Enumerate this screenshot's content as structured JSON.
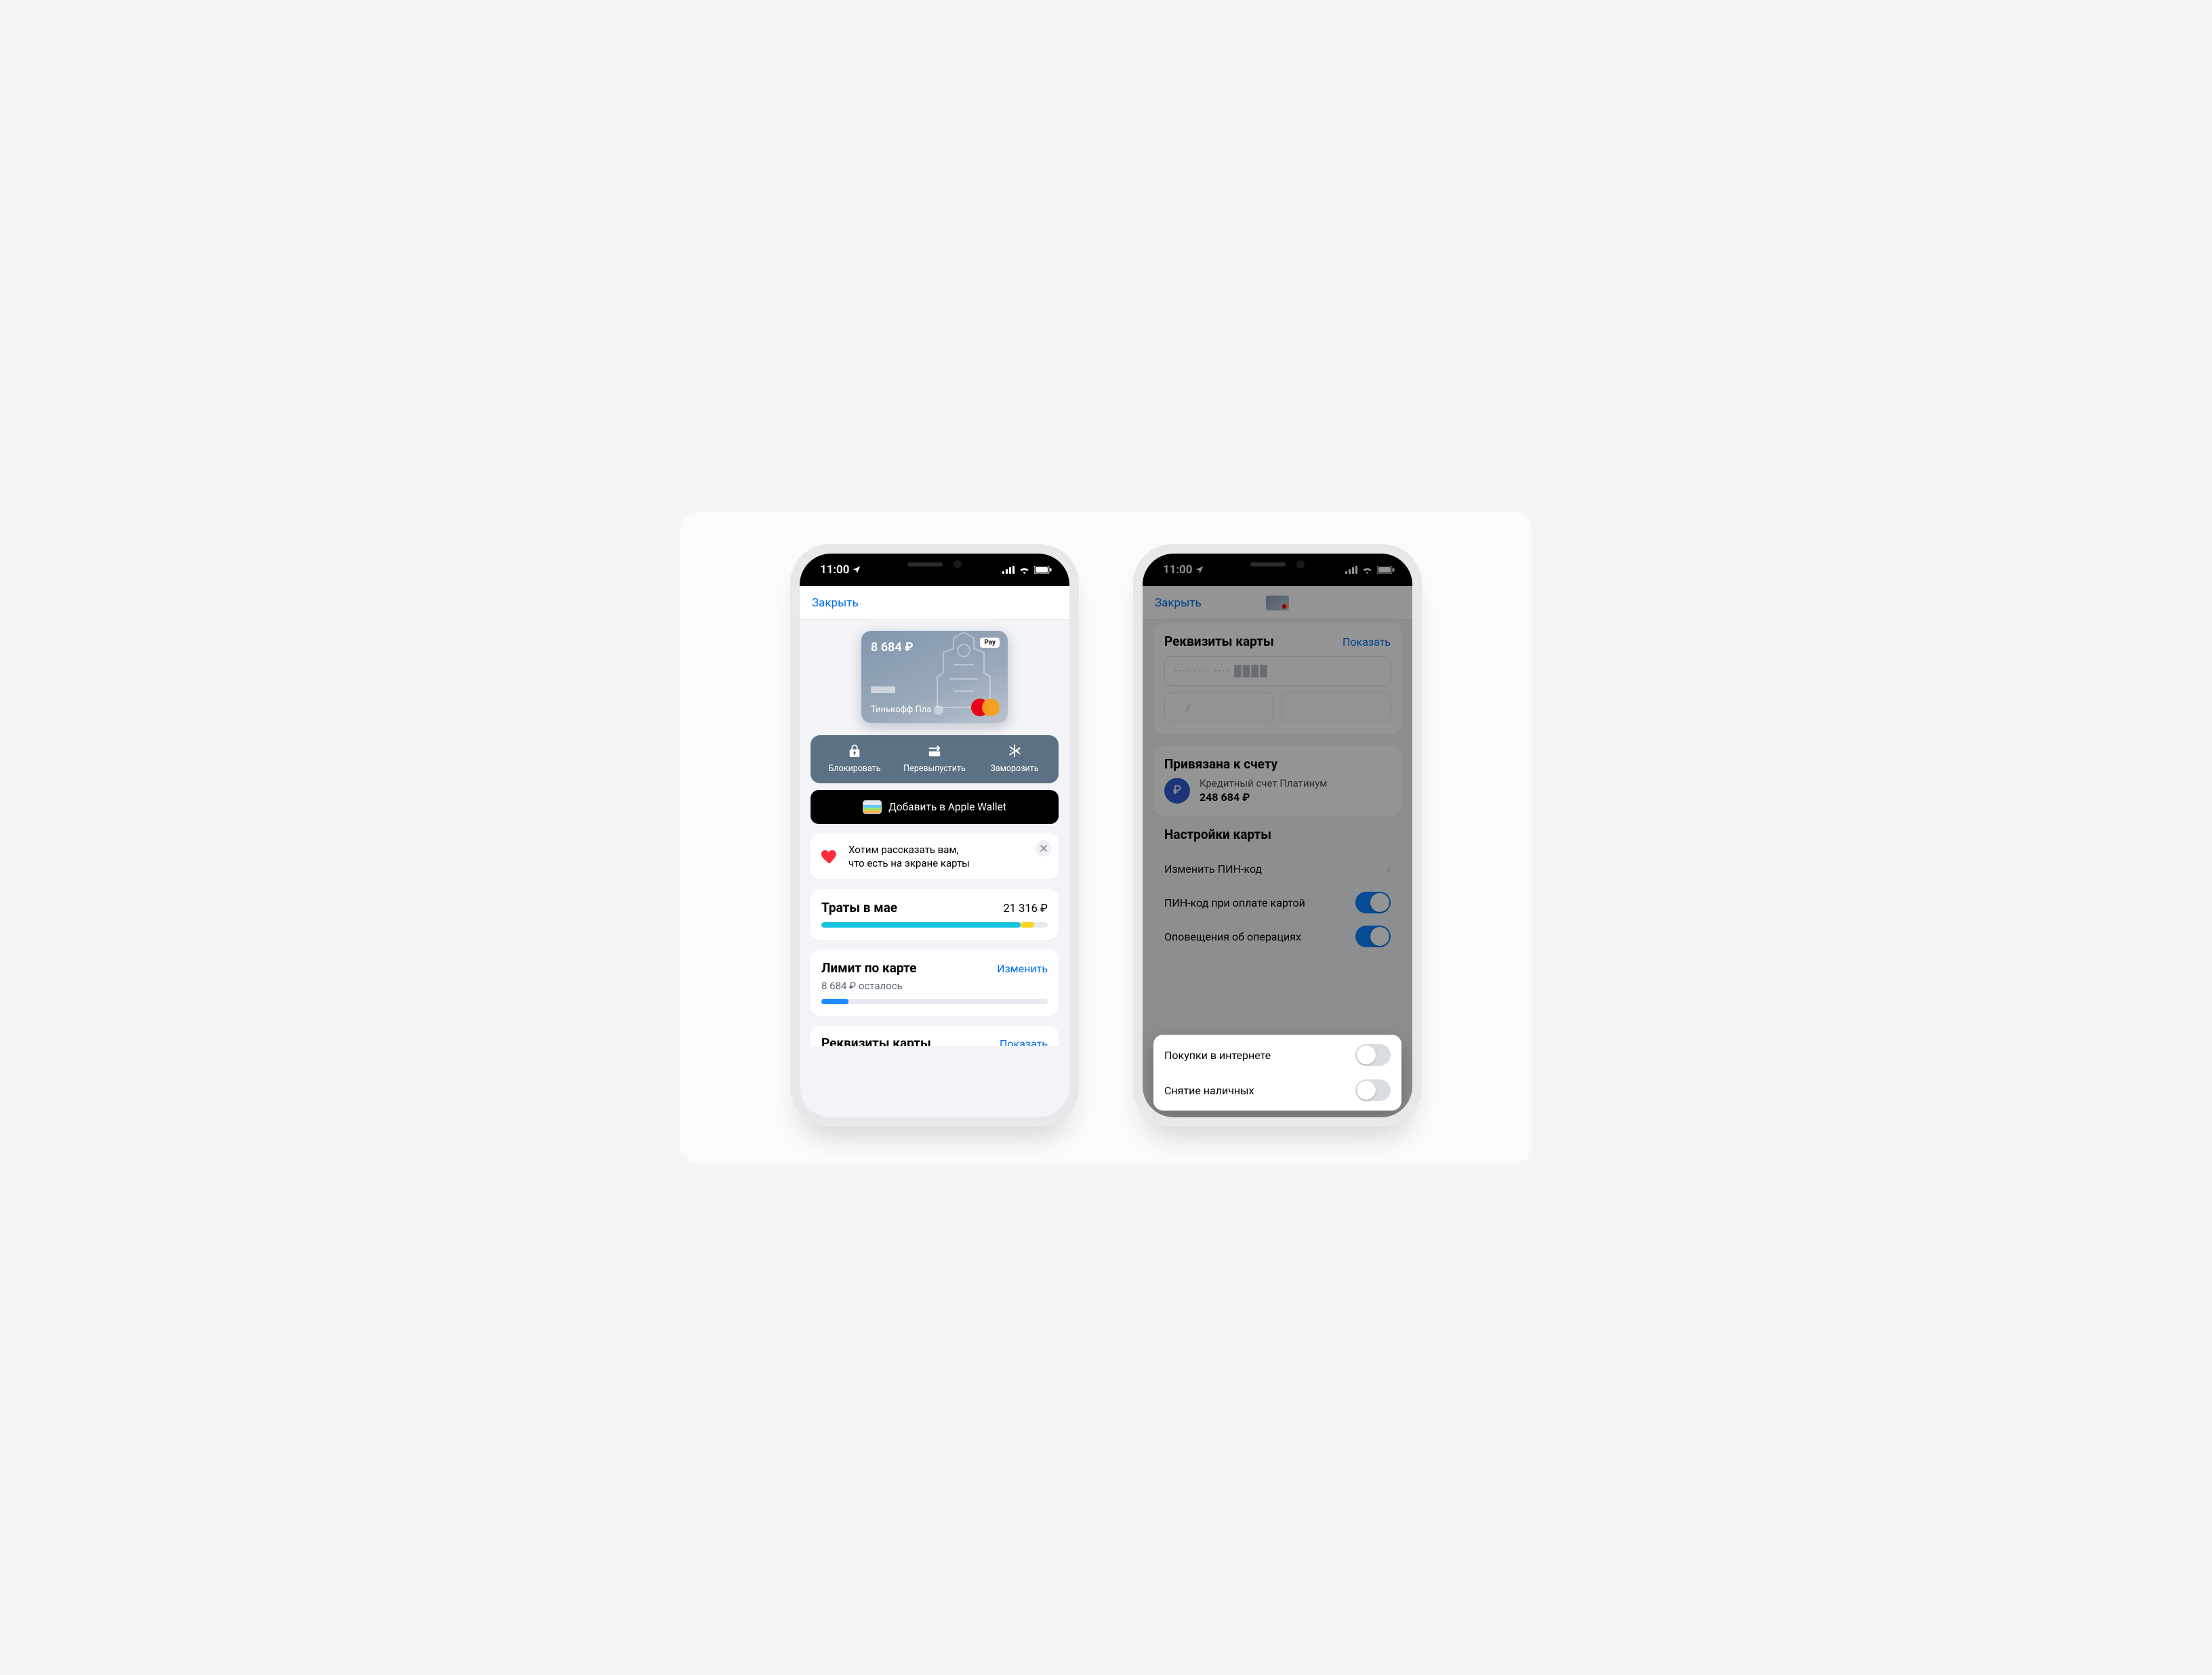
{
  "status": {
    "time": "11:00"
  },
  "nav": {
    "close": "Закрыть"
  },
  "card": {
    "balance": "8 684 ₽",
    "apple_pay_badge": "Pay",
    "product_label": "Тинькофф Пла"
  },
  "actions": {
    "block": "Блокировать",
    "reissue": "Перевыпустить",
    "freeze": "Заморозить"
  },
  "wallet_button": "Добавить в Apple Wallet",
  "info_tip": {
    "line1": "Хотим рассказать вам,",
    "line2": "что есть на экране карты"
  },
  "spend": {
    "title": "Траты в мае",
    "amount": "21 316 ₽",
    "progress_pct": 88,
    "tail_pct": 6
  },
  "limit": {
    "title": "Лимит по карте",
    "change": "Изменить",
    "remaining": "8 684 ₽ осталось",
    "progress_pct": 12
  },
  "requisites": {
    "title": "Реквизиты карты",
    "show": "Показать",
    "pan_mask": "···· ····  ····  ████",
    "exp_mask": "·· / ··",
    "cvc_mask": "···"
  },
  "linked": {
    "title": "Привязана к счету",
    "acct_name": "Кредитный счет Платинум",
    "acct_balance": "248 684 ₽",
    "currency_glyph": "₽"
  },
  "settings": {
    "title": "Настройки карты",
    "change_pin": "Изменить ПИН-код",
    "pin_on_pay": "ПИН-код при оплате картой",
    "notify_ops": "Оповещения об операциях",
    "online_purchases": "Покупки в интернете",
    "cash_withdraw": "Снятие наличных"
  },
  "peek": {
    "title": "Реквизиты карты",
    "show": "Показать"
  }
}
